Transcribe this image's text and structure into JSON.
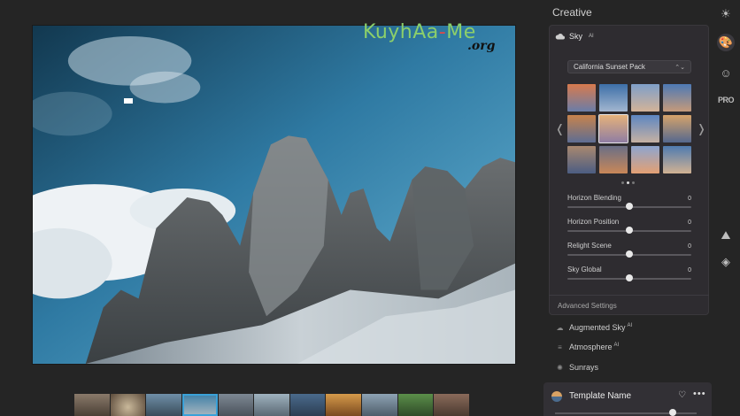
{
  "watermark": {
    "main_a": "KuyhAa",
    "dash": "-",
    "main_b": "Me",
    "sub": ".org"
  },
  "panel": {
    "title": "Creative",
    "sky": {
      "label": "Sky",
      "badge": "AI",
      "preset": "California Sunset Pack",
      "nav_prev": "❬",
      "nav_next": "❭",
      "page_count": 3,
      "active_page": 1,
      "sliders": [
        {
          "label": "Horizon Blending",
          "value": "0",
          "level": 0.5
        },
        {
          "label": "Horizon Position",
          "value": "0",
          "level": 0.5
        },
        {
          "label": "Relight Scene",
          "value": "0",
          "level": 0.5
        },
        {
          "label": "Sky Global",
          "value": "0",
          "level": 0.5
        }
      ],
      "advanced": "Advanced Settings"
    },
    "sections": [
      {
        "label": "Augmented Sky",
        "badge": "AI",
        "icon": "cloud-icon"
      },
      {
        "label": "Atmosphere",
        "badge": "AI",
        "icon": "lines-icon"
      },
      {
        "label": "Sunrays",
        "badge": "",
        "icon": "sunrays-icon"
      }
    ],
    "template": {
      "name": "Template Name",
      "heart": "♡",
      "more": "•••",
      "level": 0.83
    }
  },
  "toolbar": {
    "items": [
      {
        "icon": "sun-icon",
        "glyph": "☀"
      },
      {
        "icon": "palette-icon",
        "glyph": "🎨"
      },
      {
        "icon": "face-icon",
        "glyph": "☺"
      },
      {
        "icon": "pro-icon",
        "glyph": "PRO"
      },
      {
        "icon": "landscape-icon",
        "glyph": "⛰"
      },
      {
        "icon": "layers-icon",
        "glyph": "◈"
      }
    ]
  },
  "colors": {
    "accent": "#3aa1d8",
    "panel": "#2e2c30",
    "background": "#252525"
  }
}
